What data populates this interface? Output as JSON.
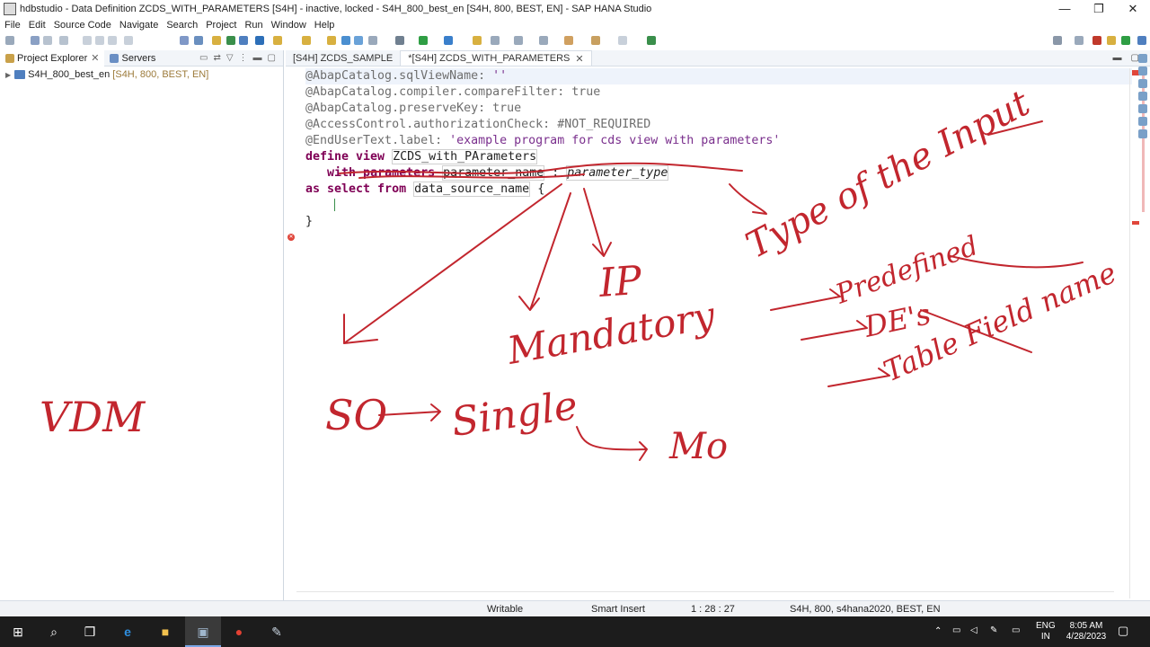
{
  "window": {
    "title": "hdbstudio - Data Definition ZCDS_WITH_PARAMETERS [S4H]  - inactive, locked - S4H_800_best_en [S4H, 800, BEST, EN] - SAP HANA Studio",
    "minimize": "—",
    "maximize": "❐",
    "close": "✕"
  },
  "menu": [
    "File",
    "Edit",
    "Source Code",
    "Navigate",
    "Search",
    "Project",
    "Run",
    "Window",
    "Help"
  ],
  "left_panel": {
    "tabs": [
      {
        "label": "Project Explorer",
        "close": "✕"
      },
      {
        "label": "Servers"
      }
    ],
    "tree": [
      {
        "label": "S4H_800_best_en",
        "decoration": "[S4H, 800, BEST, EN]"
      }
    ]
  },
  "editor": {
    "tabs": [
      {
        "label": "[S4H] ZCDS_SAMPLE"
      },
      {
        "label": "*[S4H] ZCDS_WITH_PARAMETERS",
        "close": "✕"
      }
    ],
    "code": {
      "l1a": "@AbapCatalog.sqlViewName: ",
      "l1b": "''",
      "l2": "@AbapCatalog.compiler.compareFilter: true",
      "l3": "@AbapCatalog.preserveKey: true",
      "l4": "@AccessControl.authorizationCheck: #NOT_REQUIRED",
      "l5a": "@EndUserText.label: ",
      "l5b": "'example program for cds view with parameters'",
      "l6kw": "define view",
      "l6name": "ZCDS_with_PArameters",
      "l7kw": "with parameters",
      "l7name": "parameter_name",
      "l7sep": " : ",
      "l7type": "parameter_type",
      "l8kw": "as select from",
      "l8src": "data_source_name",
      "l8brace": " {",
      "l10": "}"
    }
  },
  "annotations": {
    "ip": "IP",
    "mandatory": "Mandatory",
    "type_of_input": "Type of the Input",
    "predefined": "Predefined",
    "des": "DE's",
    "table_field": "Table Field name",
    "so": "SO",
    "single": "Single",
    "mo": "Mo",
    "vdm": "VDM"
  },
  "status": {
    "writable": "Writable",
    "insert_mode": "Smart Insert",
    "position": "1 : 28 : 27",
    "connection": "S4H, 800, s4hana2020, BEST, EN"
  },
  "taskbar": {
    "language_top": "ENG",
    "language_bottom": "IN",
    "time": "8:05 AM",
    "date": "4/28/2023"
  },
  "colors": {
    "ink": "#c2262e",
    "keyword": "#7f0055",
    "string": "#7a2f8d",
    "annotation": "#6e6e6e"
  }
}
